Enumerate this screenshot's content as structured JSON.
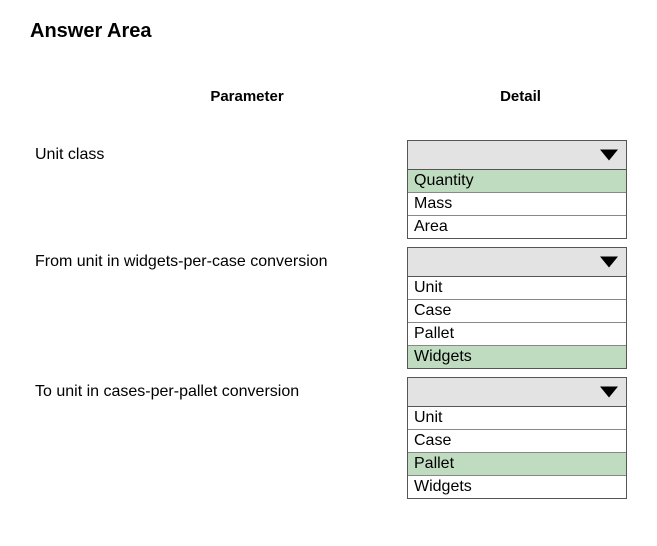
{
  "title": "Answer Area",
  "headers": {
    "parameter": "Parameter",
    "detail": "Detail"
  },
  "rows": [
    {
      "label": "Unit class",
      "options": [
        "Quantity",
        "Mass",
        "Area"
      ],
      "selected": "Quantity"
    },
    {
      "label": "From unit in widgets-per-case conversion",
      "options": [
        "Unit",
        "Case",
        "Pallet",
        "Widgets"
      ],
      "selected": "Widgets"
    },
    {
      "label": "To unit in cases-per-pallet conversion",
      "options": [
        "Unit",
        "Case",
        "Pallet",
        "Widgets"
      ],
      "selected": "Pallet"
    }
  ]
}
